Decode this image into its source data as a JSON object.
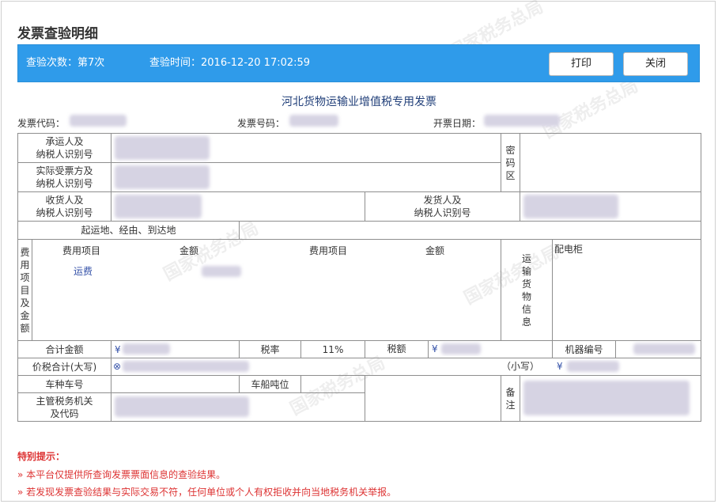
{
  "page_title": "发票查验明细",
  "header_bar": {
    "check_count": "查验次数：第7次",
    "check_time": "查验时间：2016-12-20 17:02:59",
    "print_button": "打印",
    "close_button": "关闭"
  },
  "invoice": {
    "title": "河北货物运输业增值税专用发票",
    "code_label": "发票代码：",
    "number_label": "发票号码：",
    "date_label": "开票日期："
  },
  "table": {
    "carrier_label": "承运人及\n纳税人识别号",
    "receiver_party_label": "实际受票方及\n纳税人识别号",
    "password_area_label": "密\n码\n区",
    "consignee_label": "收货人及\n纳税人识别号",
    "shipper_label": "发货人及\n纳税人识别号",
    "route_label": "起运地、经由、到达地",
    "fee_section_label": "费\n用\n项\n目\n及\n金\n额",
    "fee_item_header_1": "费用项目",
    "amount_header_1": "金额",
    "fee_item_header_2": "费用项目",
    "amount_header_2": "金额",
    "fee_item_value": "运费",
    "cargo_info_label": "运\n输\n货\n物\n信\n息",
    "cargo_info_value": "配电柜",
    "total_amount_label": "合计金额",
    "total_amount_prefix": "¥",
    "tax_rate_label": "税率",
    "tax_rate_value": "11%",
    "tax_amount_label": "税额",
    "tax_amount_prefix": "¥",
    "machine_no_label": "机器编号",
    "total_with_tax_label": "价税合计(大写)",
    "total_with_tax_prefix": "⊗",
    "small_label": "（小写）",
    "small_prefix": "¥",
    "vehicle_label": "车种车号",
    "tonnage_label": "车船吨位",
    "remarks_label": "备\n注",
    "tax_authority_label": "主管税务机关\n及代码"
  },
  "notes": {
    "head": "特别提示：",
    "line1": "»  本平台仅提供所查询发票票面信息的查验结果。",
    "line2": "»  若发现发票查验结果与实际交易不符，任何单位或个人有权拒收并向当地税务机关举报。"
  },
  "watermark_text": "国家税务总局"
}
